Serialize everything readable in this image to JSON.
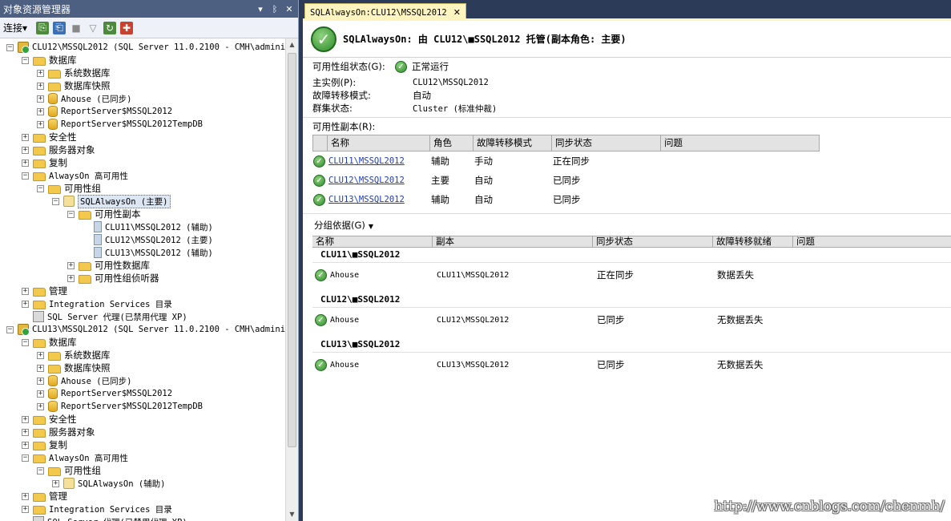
{
  "object_explorer": {
    "title": "对象资源管理器",
    "title_buttons": [
      "▾",
      "ᛒ",
      "✕"
    ],
    "toolbar": {
      "connect_label": "连接",
      "connect_arrow": "▾"
    },
    "tree": [
      {
        "depth": 0,
        "exp": "−",
        "icon": "server",
        "label": "CLU12\\MSSQL2012 (SQL Server 11.0.2100 - CMH\\administ",
        "mono": true
      },
      {
        "depth": 1,
        "exp": "−",
        "icon": "folder",
        "label": "数据库"
      },
      {
        "depth": 2,
        "exp": "+",
        "icon": "folder",
        "label": "系统数据库"
      },
      {
        "depth": 2,
        "exp": "+",
        "icon": "folder",
        "label": "数据库快照"
      },
      {
        "depth": 2,
        "exp": "+",
        "icon": "db",
        "label": "Ahouse (已同步)",
        "mono": true
      },
      {
        "depth": 2,
        "exp": "+",
        "icon": "db",
        "label": "ReportServer$MSSQL2012",
        "mono": true
      },
      {
        "depth": 2,
        "exp": "+",
        "icon": "db",
        "label": "ReportServer$MSSQL2012TempDB",
        "mono": true
      },
      {
        "depth": 1,
        "exp": "+",
        "icon": "folder",
        "label": "安全性"
      },
      {
        "depth": 1,
        "exp": "+",
        "icon": "folder",
        "label": "服务器对象"
      },
      {
        "depth": 1,
        "exp": "+",
        "icon": "folder",
        "label": "复制"
      },
      {
        "depth": 1,
        "exp": "−",
        "icon": "folder",
        "label": "AlwaysOn 高可用性",
        "mono": true
      },
      {
        "depth": 2,
        "exp": "−",
        "icon": "folder",
        "label": "可用性组"
      },
      {
        "depth": 3,
        "exp": "−",
        "icon": "ag",
        "label": "SQLAlwaysOn (主要)",
        "mono": true,
        "selected": true
      },
      {
        "depth": 4,
        "exp": "−",
        "icon": "folder",
        "label": "可用性副本"
      },
      {
        "depth": 5,
        "exp": "",
        "icon": "replica",
        "label": "CLU11\\MSSQL2012 (辅助)",
        "mono": true
      },
      {
        "depth": 5,
        "exp": "",
        "icon": "replica",
        "label": "CLU12\\MSSQL2012 (主要)",
        "mono": true
      },
      {
        "depth": 5,
        "exp": "",
        "icon": "replica",
        "label": "CLU13\\MSSQL2012 (辅助)",
        "mono": true
      },
      {
        "depth": 4,
        "exp": "+",
        "icon": "folder",
        "label": "可用性数据库"
      },
      {
        "depth": 4,
        "exp": "+",
        "icon": "folder",
        "label": "可用性组侦听器"
      },
      {
        "depth": 1,
        "exp": "+",
        "icon": "folder",
        "label": "管理"
      },
      {
        "depth": 1,
        "exp": "+",
        "icon": "folder",
        "label": "Integration Services 目录",
        "mono": true
      },
      {
        "depth": 1,
        "exp": "",
        "icon": "agent",
        "label": "SQL Server 代理(已禁用代理 XP)",
        "mono": true
      },
      {
        "depth": 0,
        "exp": "−",
        "icon": "server",
        "label": "CLU13\\MSSQL2012 (SQL Server 11.0.2100 - CMH\\administ",
        "mono": true
      },
      {
        "depth": 1,
        "exp": "−",
        "icon": "folder",
        "label": "数据库"
      },
      {
        "depth": 2,
        "exp": "+",
        "icon": "folder",
        "label": "系统数据库"
      },
      {
        "depth": 2,
        "exp": "+",
        "icon": "folder",
        "label": "数据库快照"
      },
      {
        "depth": 2,
        "exp": "+",
        "icon": "db",
        "label": "Ahouse (已同步)",
        "mono": true
      },
      {
        "depth": 2,
        "exp": "+",
        "icon": "db",
        "label": "ReportServer$MSSQL2012",
        "mono": true
      },
      {
        "depth": 2,
        "exp": "+",
        "icon": "db",
        "label": "ReportServer$MSSQL2012TempDB",
        "mono": true
      },
      {
        "depth": 1,
        "exp": "+",
        "icon": "folder",
        "label": "安全性"
      },
      {
        "depth": 1,
        "exp": "+",
        "icon": "folder",
        "label": "服务器对象"
      },
      {
        "depth": 1,
        "exp": "+",
        "icon": "folder",
        "label": "复制"
      },
      {
        "depth": 1,
        "exp": "−",
        "icon": "folder",
        "label": "AlwaysOn 高可用性",
        "mono": true
      },
      {
        "depth": 2,
        "exp": "−",
        "icon": "folder",
        "label": "可用性组"
      },
      {
        "depth": 3,
        "exp": "+",
        "icon": "ag",
        "label": "SQLAlwaysOn (辅助)",
        "mono": true
      },
      {
        "depth": 1,
        "exp": "+",
        "icon": "folder",
        "label": "管理"
      },
      {
        "depth": 1,
        "exp": "+",
        "icon": "folder",
        "label": "Integration Services 目录",
        "mono": true
      },
      {
        "depth": 1,
        "exp": "",
        "icon": "agent",
        "label": "SQL Server 代理(已禁用代理 XP)",
        "mono": true
      }
    ]
  },
  "dashboard": {
    "tab_title": "SQLAlwaysOn:CLU12\\MSSQL2012",
    "tab_close": "✕",
    "header": "SQLAlwaysOn: 由 CLU12\\■SSQL2012 托管(副本角色: 主要)",
    "status_label": "可用性组状态(G):",
    "status_value": "正常运行",
    "primary_label": "主实例(P):",
    "primary_value": "CLU12\\MSSQL2012",
    "failover_label": "故障转移模式:",
    "failover_value": "自动",
    "cluster_label": "群集状态:",
    "cluster_value": "Cluster (标准仲裁)",
    "replicas_label": "可用性副本(R):",
    "replica_columns": [
      "名称",
      "角色",
      "故障转移模式",
      "同步状态",
      "问题"
    ],
    "replicas": [
      {
        "name": "CLU11\\MSSQL2012",
        "role": "辅助",
        "failover": "手动",
        "sync": "正在同步",
        "issues": ""
      },
      {
        "name": "CLU12\\MSSQL2012",
        "role": "主要",
        "failover": "自动",
        "sync": "已同步",
        "issues": ""
      },
      {
        "name": "CLU13\\MSSQL2012",
        "role": "辅助",
        "failover": "自动",
        "sync": "已同步",
        "issues": ""
      }
    ],
    "groupby_label": "分组依据(G)",
    "db_columns": [
      "名称",
      "副本",
      "同步状态",
      "故障转移就绪",
      "问题"
    ],
    "db_groups": [
      {
        "title": "CLU11\\■SSQL2012",
        "rows": [
          {
            "name": "Ahouse",
            "replica": "CLU11\\MSSQL2012",
            "sync": "正在同步",
            "ready": "数据丢失",
            "issues": ""
          }
        ]
      },
      {
        "title": "CLU12\\■SSQL2012",
        "rows": [
          {
            "name": "Ahouse",
            "replica": "CLU12\\MSSQL2012",
            "sync": "已同步",
            "ready": "无数据丢失",
            "issues": ""
          }
        ]
      },
      {
        "title": "CLU13\\■SSQL2012",
        "rows": [
          {
            "name": "Ahouse",
            "replica": "CLU13\\MSSQL2012",
            "sync": "已同步",
            "ready": "无数据丢失",
            "issues": ""
          }
        ]
      }
    ]
  },
  "watermark": "http://www.cnblogs.com/chenmh/",
  "colors": {
    "title_bar": "#4d6082",
    "workspace": "#2b3b58",
    "tab": "#fdf4bf",
    "ok_green": "#2d8a2a",
    "link": "#1d3bbf"
  }
}
